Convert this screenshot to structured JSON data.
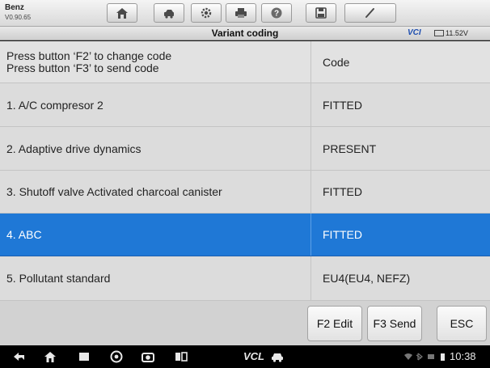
{
  "header": {
    "brand": "Benz",
    "version": "V0.90.65",
    "toolbar": [
      {
        "icon": "home-icon"
      },
      {
        "icon": "vehicle-swap-icon"
      },
      {
        "icon": "gear-icon"
      },
      {
        "icon": "printer-icon"
      },
      {
        "icon": "help-icon"
      },
      {
        "icon": "save-icon"
      },
      {
        "icon": "edit-pen-icon"
      }
    ]
  },
  "titlebar": {
    "title": "Variant coding",
    "vci_label": "VCI",
    "voltage": "11.52V"
  },
  "table": {
    "instructions": [
      "Press button ‘F2’ to change code",
      "Press button ‘F3’ to send code"
    ],
    "code_header": "Code",
    "rows": [
      {
        "label": "1. A/C compresor 2",
        "value": "FITTED",
        "selected": false
      },
      {
        "label": "2. Adaptive drive dynamics",
        "value": "PRESENT",
        "selected": false
      },
      {
        "label": "3. Shutoff valve Activated charcoal canister",
        "value": "FITTED",
        "selected": false
      },
      {
        "label": "4. ABC",
        "value": "FITTED",
        "selected": true
      },
      {
        "label": "5. Pollutant standard",
        "value": "EU4(EU4, NEFZ)",
        "selected": false
      }
    ]
  },
  "footer": {
    "f2_label": "F2 Edit",
    "f3_label": "F3 Send",
    "esc_label": "ESC"
  },
  "navbar": {
    "vcl_label": "VCL",
    "clock": "10:38"
  },
  "colors": {
    "selection": "#1f78d6",
    "row_bg": "#dcdcdc",
    "vci_accent": "#1f4fb0"
  }
}
